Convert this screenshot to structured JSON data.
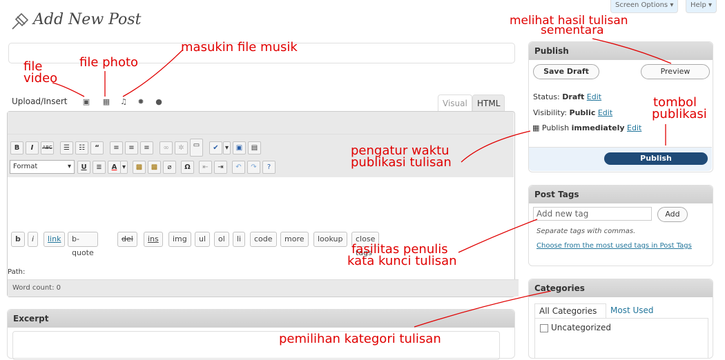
{
  "page": {
    "title": "Add New Post"
  },
  "top_tabs": {
    "screen_options": "Screen Options ▾",
    "help": "Help ▾"
  },
  "media": {
    "upload_label": "Upload/Insert",
    "icons": [
      "video-icon",
      "image-icon",
      "music-icon",
      "media-icon",
      "other-icon"
    ]
  },
  "editor_tabs": {
    "visual": "Visual",
    "html": "HTML"
  },
  "quicktags": [
    "b",
    "i",
    "link",
    "b-quote",
    "del",
    "ins",
    "img",
    "ul",
    "ol",
    "li",
    "code",
    "more",
    "lookup",
    "close tags"
  ],
  "tinymce": {
    "format": "Format"
  },
  "editor": {
    "path_label": "Path:",
    "word_count": "Word count: 0"
  },
  "excerpt": {
    "title": "Excerpt"
  },
  "publish": {
    "title": "Publish",
    "save_draft": "Save Draft",
    "preview": "Preview",
    "status_label": "Status:",
    "status_value": "Draft",
    "status_edit": "Edit",
    "visibility_label": "Visibility:",
    "visibility_value": "Public",
    "visibility_edit": "Edit",
    "schedule_label": "Publish",
    "schedule_value": "immediately",
    "schedule_edit": "Edit",
    "publish_button": "Publish"
  },
  "tags": {
    "title": "Post Tags",
    "placeholder": "Add new tag",
    "add": "Add",
    "hint": "Separate tags with commas.",
    "choose_link": "Choose from the most used tags in Post Tags"
  },
  "categories": {
    "title": "Categories",
    "tab_all": "All Categories",
    "tab_most": "Most Used",
    "items": [
      "Uncategorized"
    ]
  },
  "annotations": {
    "file_video": [
      "file",
      "video"
    ],
    "file_photo": "file photo",
    "music": "masukin file musik",
    "preview": [
      "melihat hasil tulisan",
      "sementara"
    ],
    "publish_btn": [
      "tombol",
      "publikasi"
    ],
    "schedule": [
      "pengatur waktu",
      "publikasi tulisan"
    ],
    "tags": [
      "fasilitas penulis",
      "kata kunci tulisan"
    ],
    "category": "pemilihan kategori tulisan"
  },
  "colors": {
    "annotation": "#e00000",
    "link": "#21759b",
    "publish_button": "#1f4a77"
  }
}
